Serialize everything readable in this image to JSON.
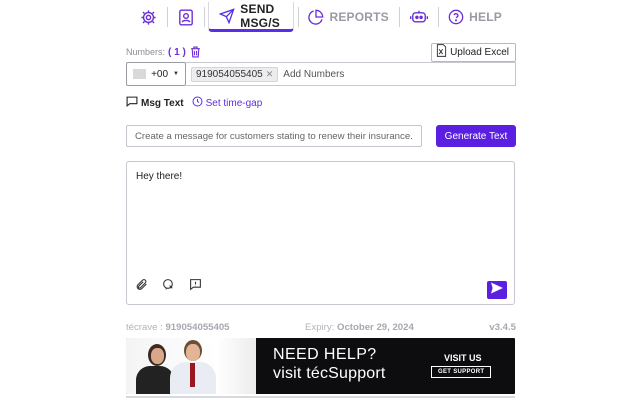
{
  "nav": {
    "settings_icon": "gear-icon",
    "contacts_icon": "contact-card-icon",
    "send_label": "SEND MSG/S",
    "reports_label": "REPORTS",
    "bot_icon": "robot-icon",
    "help_label": "HELP"
  },
  "numbers": {
    "label": "Numbers:",
    "count": "( 1 )",
    "upload_label": "Upload Excel"
  },
  "country_code": "+00",
  "chips": [
    "919054055405"
  ],
  "add_numbers_placeholder": "Add Numbers",
  "tabs": {
    "msg_text": "Msg Text",
    "time_gap": "Set time-gap"
  },
  "prompt": {
    "placeholder": "Create a message for customers stating to renew their insurance.",
    "generate_label": "Generate Text"
  },
  "message": {
    "text": "Hey there!"
  },
  "footer": {
    "account_prefix": "técrave :",
    "account_number": "919054055405",
    "expiry_label": "Expiry:",
    "expiry_date": "October 29, 2024",
    "version": "v3.4.5"
  },
  "banner": {
    "title": "NEED HELP?",
    "subtitle": "visit técSupport",
    "visit_label": "VISIT US",
    "cta_label": "GET SUPPORT"
  },
  "colors": {
    "accent": "#5a1fe0",
    "nav_purple": "#6b2fd6",
    "muted": "#9a9aa6"
  }
}
